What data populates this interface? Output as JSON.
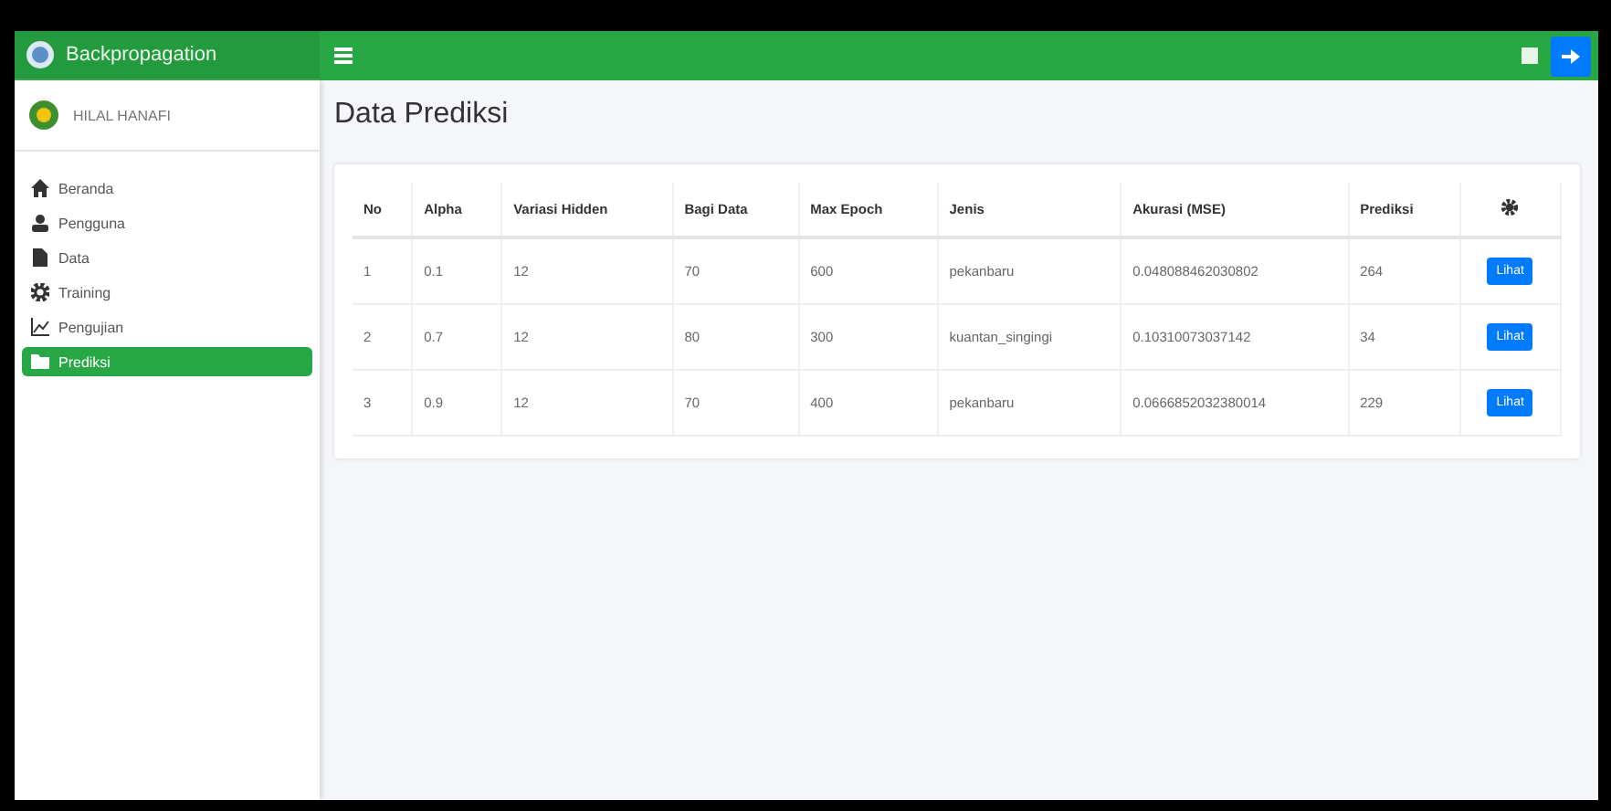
{
  "brand": {
    "title": "Backpropagation"
  },
  "user": {
    "name": "HILAL HANAFI"
  },
  "sidebar": {
    "items": [
      {
        "label": "Beranda",
        "selected": false
      },
      {
        "label": "Pengguna",
        "selected": false
      },
      {
        "label": "Data",
        "selected": false
      },
      {
        "label": "Training",
        "selected": false
      },
      {
        "label": "Pengujian",
        "selected": false
      },
      {
        "label": "Prediksi",
        "selected": true
      }
    ]
  },
  "page": {
    "title": "Data Prediksi"
  },
  "table": {
    "columns": [
      "No",
      "Alpha",
      "Variasi Hidden",
      "Bagi Data",
      "Max Epoch",
      "Jenis",
      "Akurasi (MSE)",
      "Prediksi"
    ],
    "rows": [
      {
        "cells": [
          "1",
          "0.1",
          "12",
          "70",
          "600",
          "pekanbaru",
          "0.048088462030802",
          "264"
        ],
        "action": "Lihat"
      },
      {
        "cells": [
          "2",
          "0.7",
          "12",
          "80",
          "300",
          "kuantan_singingi",
          "0.10310073037142",
          "34"
        ],
        "action": "Lihat"
      },
      {
        "cells": [
          "3",
          "0.9",
          "12",
          "70",
          "400",
          "pekanbaru",
          "0.0666852032380014",
          "229"
        ],
        "action": "Lihat"
      }
    ]
  }
}
